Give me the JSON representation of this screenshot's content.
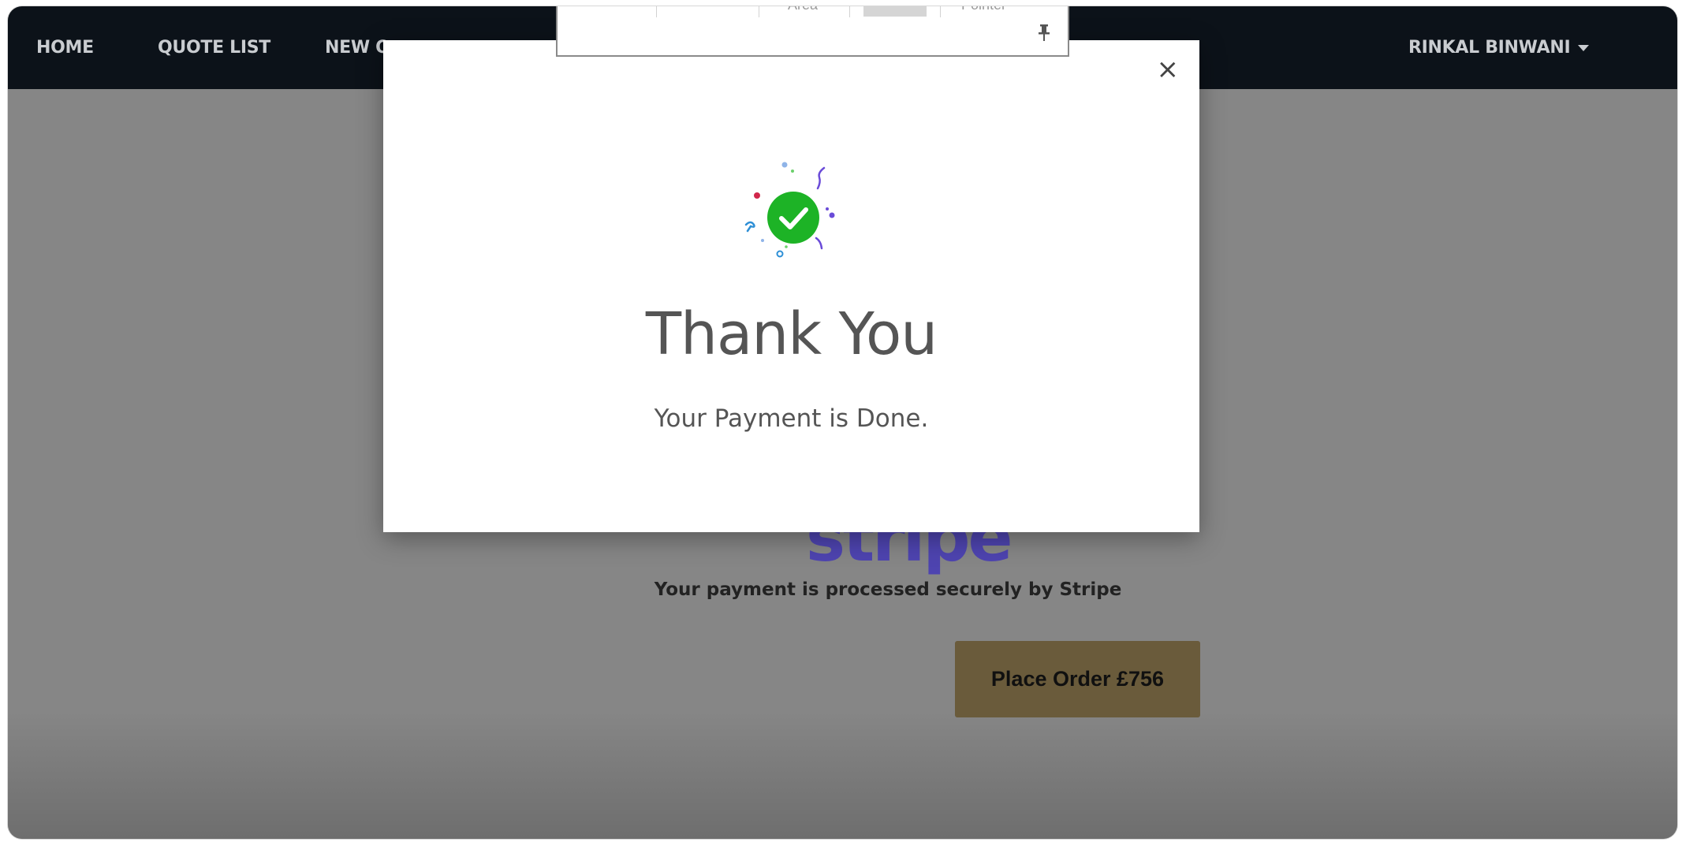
{
  "nav": {
    "items": [
      {
        "label": "HOME"
      },
      {
        "label": "QUOTE LIST"
      },
      {
        "label": "NEW Q"
      }
    ],
    "user_label": "RINKAL BINWANI"
  },
  "page": {
    "brand_logo_text": "stripe",
    "secure_text": "Your payment is processed securely by Stripe",
    "place_order_label": "Place Order £756"
  },
  "modal": {
    "close_symbol": "×",
    "title": "Thank You",
    "message": "Your Payment is Done."
  },
  "toolbar": {
    "area_label": "Area",
    "pointer_label": "Pointer",
    "pin_icon": "pin-icon"
  },
  "colors": {
    "nav_bg": "#0c1219",
    "success_green": "#1db326",
    "stripe_purple": "#4e44b0",
    "order_button": "#6a5b3b"
  }
}
